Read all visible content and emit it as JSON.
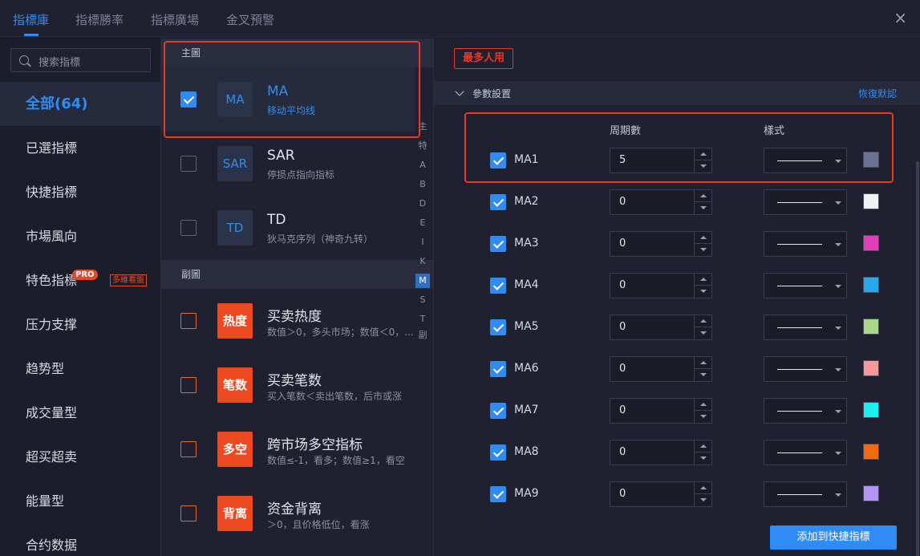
{
  "tabs": [
    {
      "label": "指標庫",
      "active": true
    },
    {
      "label": "指標勝率",
      "active": false
    },
    {
      "label": "指標廣場",
      "active": false
    },
    {
      "label": "金叉預警",
      "active": false
    }
  ],
  "close_label": "×",
  "search": {
    "placeholder": "搜索指標"
  },
  "categories": [
    {
      "label": "全部(64)",
      "active": true
    },
    {
      "label": "已選指標"
    },
    {
      "label": "快捷指標"
    },
    {
      "label": "市場風向"
    },
    {
      "label": "特色指標",
      "badge": "PRO",
      "tag": "多維看盤"
    },
    {
      "label": "压力支撑"
    },
    {
      "label": "趋势型"
    },
    {
      "label": "成交量型"
    },
    {
      "label": "超买超卖"
    },
    {
      "label": "能量型"
    },
    {
      "label": "合约数据"
    }
  ],
  "sections": {
    "main": {
      "label": "主圖"
    },
    "sub": {
      "label": "副圖"
    }
  },
  "indicators_main": [
    {
      "logo": "MA",
      "name": "MA",
      "desc": "移动平均线",
      "checked": true,
      "selected": true
    },
    {
      "logo": "SAR",
      "name": "SAR",
      "desc": "停损点指向指标",
      "checked": false
    },
    {
      "logo": "TD",
      "name": "TD",
      "desc": "狄马克序列（神奇九转）",
      "checked": false
    }
  ],
  "indicators_sub": [
    {
      "logo": "热度",
      "name": "买卖热度",
      "desc": "数值＞0，多头市场；数值＜0，..."
    },
    {
      "logo": "笔数",
      "name": "买卖笔数",
      "desc": "买入笔数＜卖出笔数，后市或涨"
    },
    {
      "logo": "多空",
      "name": "跨市场多空指标",
      "desc": "数值≤-1，看多；数值≥1，看空"
    },
    {
      "logo": "背离",
      "name": "资金背离",
      "desc": "＞0，且价格低位，看涨"
    }
  ],
  "alpha_index": [
    "主",
    "特",
    "A",
    "B",
    "D",
    "E",
    "I",
    "K",
    "M",
    "S",
    "T",
    "副"
  ],
  "alpha_active": "M",
  "right": {
    "popular_label": "最多人用",
    "param_title": "參數設置",
    "reset_label": "恢復默認",
    "col_period": "周期數",
    "col_style": "樣式",
    "add_label": "添加到快捷指標"
  },
  "ma_rows": [
    {
      "label": "MA1",
      "value": "5",
      "color": "#6b7394"
    },
    {
      "label": "MA2",
      "value": "0",
      "color": "#f2f2f2"
    },
    {
      "label": "MA3",
      "value": "0",
      "color": "#e040b5"
    },
    {
      "label": "MA4",
      "value": "0",
      "color": "#2aa7e8"
    },
    {
      "label": "MA5",
      "value": "0",
      "color": "#a8d98a"
    },
    {
      "label": "MA6",
      "value": "0",
      "color": "#f59a9a"
    },
    {
      "label": "MA7",
      "value": "0",
      "color": "#19f0f0"
    },
    {
      "label": "MA8",
      "value": "0",
      "color": "#f06a12"
    },
    {
      "label": "MA9",
      "value": "0",
      "color": "#b394f5"
    }
  ]
}
